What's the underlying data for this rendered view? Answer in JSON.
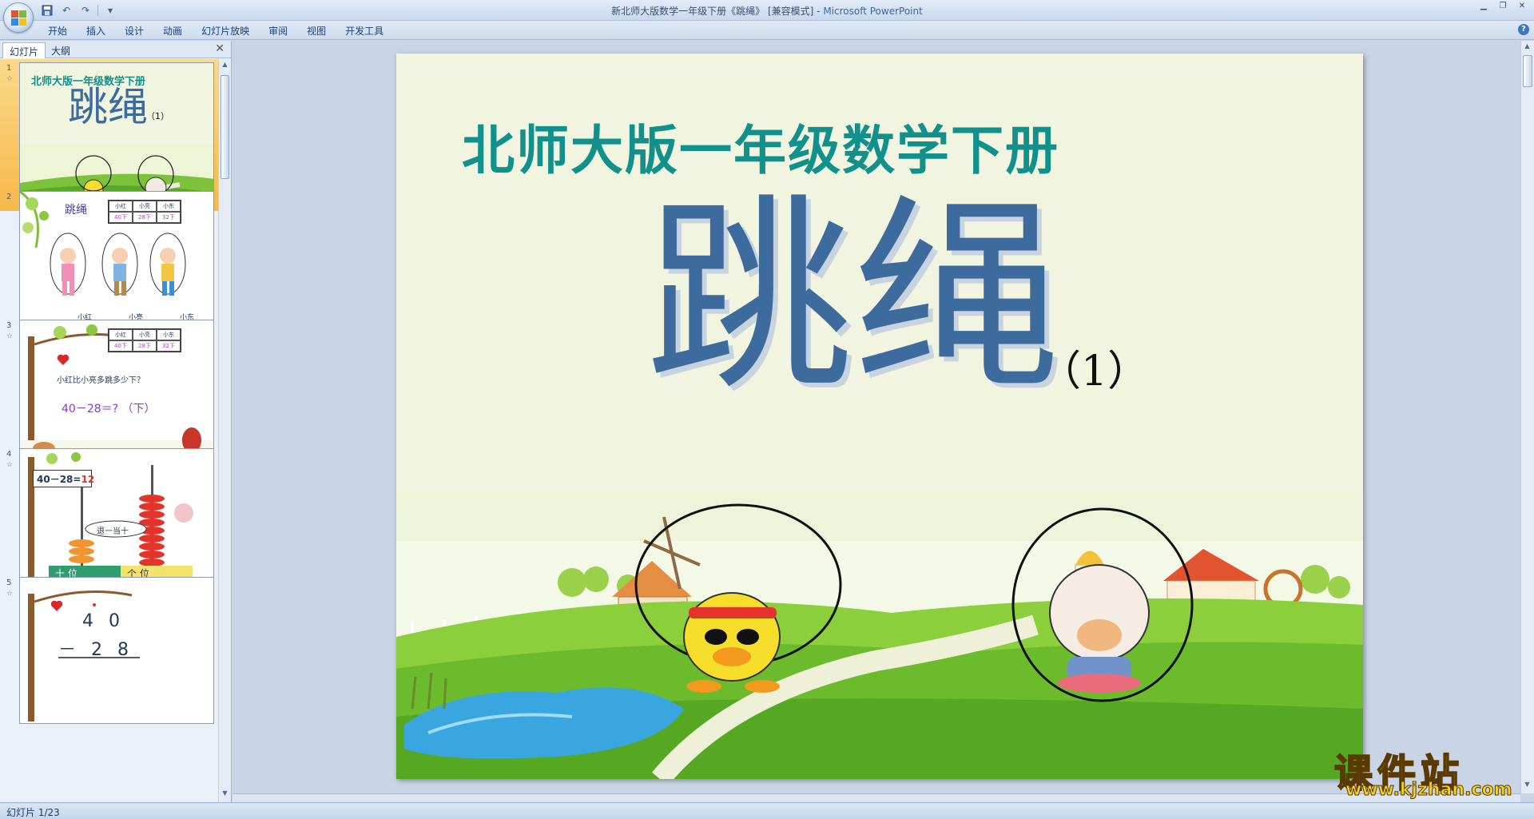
{
  "window": {
    "title_doc": "新北师大版数学一年级下册《跳绳》 [兼容模式] - ",
    "title_app": "Microsoft PowerPoint"
  },
  "ribbon": {
    "tabs": [
      {
        "label": "开始"
      },
      {
        "label": "插入"
      },
      {
        "label": "设计"
      },
      {
        "label": "动画"
      },
      {
        "label": "幻灯片放映"
      },
      {
        "label": "审阅"
      },
      {
        "label": "视图"
      },
      {
        "label": "开发工具"
      }
    ],
    "help": "?"
  },
  "pane": {
    "tab_slides": "幻灯片",
    "tab_outline": "大纲",
    "close": "✕"
  },
  "thumbnails": [
    {
      "num": "1",
      "line1": "北师大版一年级数学下册",
      "line2": "跳绳",
      "line3": "（1）"
    },
    {
      "num": "2",
      "title": "跳绳",
      "headers": [
        "小红",
        "小亮",
        "小东"
      ],
      "values": [
        "40下",
        "28下",
        "32下"
      ],
      "names": [
        "小红",
        "小亮",
        "小东"
      ]
    },
    {
      "num": "3",
      "headers": [
        "小红",
        "小亮",
        "小东"
      ],
      "values": [
        "40下",
        "28下",
        "32下"
      ],
      "question": "小红比小亮多跳多少下？",
      "equation": "40－28＝?  （下）"
    },
    {
      "num": "4",
      "eq_left": "40－28=",
      "eq_right": "12",
      "borrow": "退一当十",
      "tens": "十  位",
      "ones": "个  位"
    },
    {
      "num": "5",
      "row1": "4 0",
      "row2": "－ 2 8"
    }
  ],
  "slide": {
    "subtitle": "北师大版一年级数学下册",
    "title": "跳绳",
    "number": "（1）"
  },
  "status": {
    "text": "幻灯片 1/23"
  },
  "watermark": {
    "main": "课件站",
    "url": "www.kjzhan.com"
  },
  "colors": {
    "subtitle": "#12918c",
    "title": "#3d6b9e",
    "selected_thumb": "#f6b94a"
  }
}
